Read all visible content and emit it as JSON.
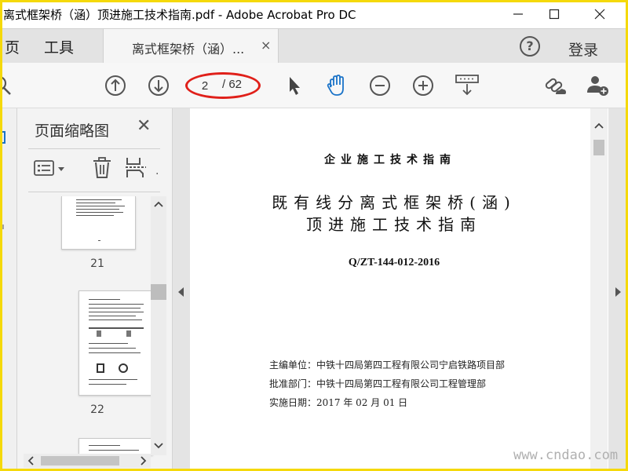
{
  "window": {
    "title": "离式框架桥（涵）顶进施工技术指南.pdf - Adobe Acrobat Pro DC",
    "minimize_glyph": "—",
    "maximize_glyph": "☐",
    "close_glyph": "✕"
  },
  "tabs": {
    "home_label": "页",
    "tools_label": "工具",
    "document_label": "离式框架桥（涵）...",
    "document_close": "×",
    "help_label": "?",
    "login_label": "登录"
  },
  "toolbar": {
    "current_page": "2",
    "total_pages": "/ 62",
    "icons": [
      "search-icon",
      "page-up-icon",
      "page-down-icon",
      "select-arrow-icon",
      "hand-tool-icon",
      "zoom-out-icon",
      "zoom-in-icon",
      "keyboard-scroll-icon",
      "share-link-icon",
      "add-user-icon"
    ]
  },
  "thumbnail_panel": {
    "title": "页面缩略图",
    "close_label": "✕",
    "pages": [
      {
        "label": "21"
      },
      {
        "label": "22"
      }
    ]
  },
  "document": {
    "header": "企业施工技术指南",
    "title_line1": "既有线分离式框架桥(涵)",
    "title_line2": "顶进施工技术指南",
    "code": "Q/ZT-144-012-2016",
    "meta": [
      {
        "text": "主编单位：中铁十四局第四工程有限公司宁启铁路项目部"
      },
      {
        "text": "批准部门：中铁十四局第四工程有限公司工程管理部"
      },
      {
        "text": "实施日期：2017 年 02 月 01 日"
      }
    ]
  },
  "watermark": "www.cndao.com",
  "colors": {
    "accent_blue": "#1a73c8",
    "annotation_red": "#e0201a",
    "frame_yellow": "#f5d90a"
  }
}
